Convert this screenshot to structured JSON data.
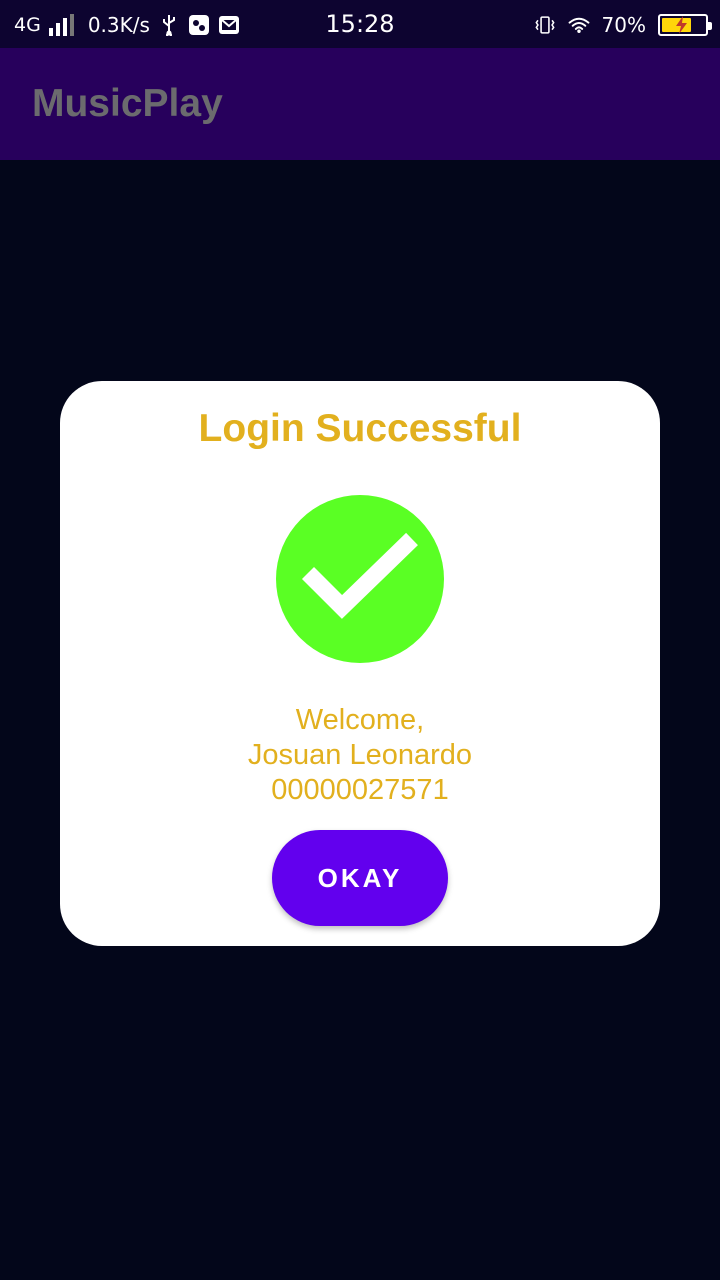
{
  "status_bar": {
    "network": "4G",
    "speed": "0.3K/s",
    "time": "15:28",
    "battery": "70%",
    "battery_level": 0.7,
    "icons": [
      "signal-icon",
      "usb-icon",
      "app-notification-icon",
      "message-icon",
      "vibrate-icon",
      "wifi-icon",
      "battery-charging-icon"
    ]
  },
  "app_bar": {
    "title": "MusicPlay"
  },
  "dialog": {
    "title": "Login Successful",
    "icon": "check-circle-icon",
    "welcome_line": "Welcome,",
    "user_name": "Josuan Leonardo",
    "user_id": "00000027571",
    "okay_label": "OKAY"
  },
  "colors": {
    "background": "#03061a",
    "app_bar": "#27005c",
    "accent_gold": "#e2b01e",
    "success_green": "#5aff24",
    "button_purple": "#6200ee"
  }
}
